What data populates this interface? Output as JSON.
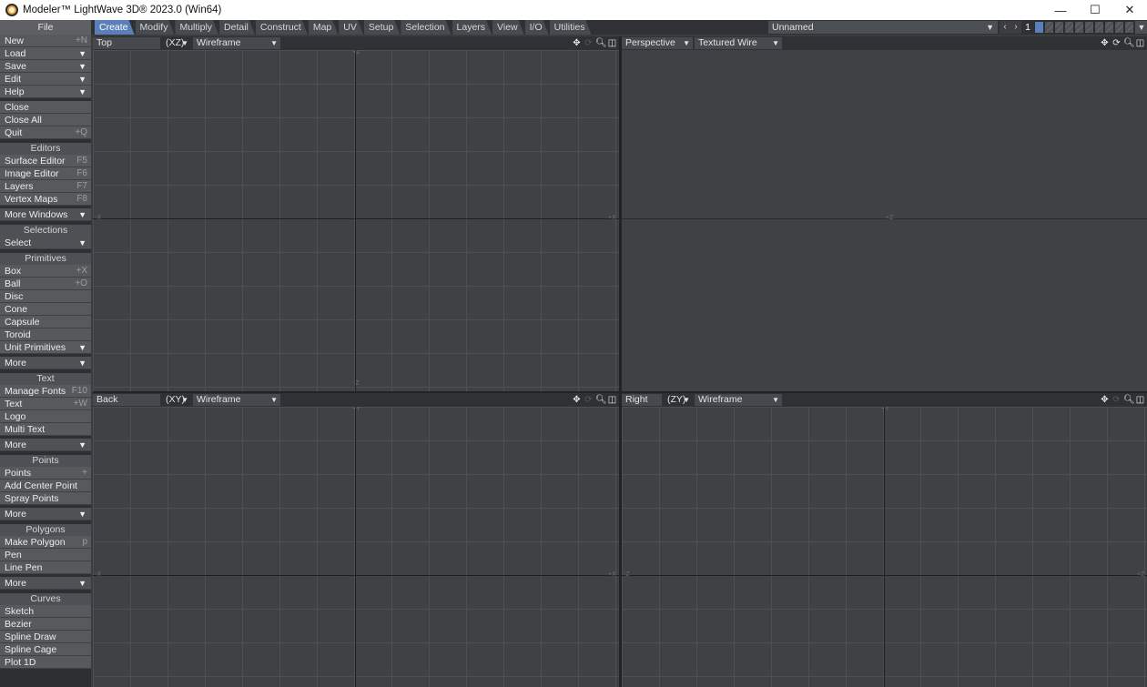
{
  "window": {
    "title": "Modeler™ LightWave 3D® 2023.0 (Win64)",
    "minimize": "—",
    "maximize": "☐",
    "close": "✕"
  },
  "tabbar": {
    "file_label": "File",
    "tabs": [
      {
        "label": "Create",
        "active": true
      },
      {
        "label": "Modify"
      },
      {
        "label": "Multiply"
      },
      {
        "label": "Detail"
      },
      {
        "label": "Construct"
      },
      {
        "label": "Map"
      },
      {
        "label": "UV"
      },
      {
        "label": "Setup"
      },
      {
        "label": "Selection"
      },
      {
        "label": "Layers"
      },
      {
        "label": "View"
      },
      {
        "label": "I/O"
      },
      {
        "label": "Utilities"
      }
    ],
    "object_name": "Unnamed",
    "layer_number": "1"
  },
  "sidebar": {
    "file": {
      "new": {
        "label": "New",
        "shortcut": "+N"
      },
      "load": {
        "label": "Load"
      },
      "save": {
        "label": "Save"
      },
      "edit": {
        "label": "Edit"
      },
      "help": {
        "label": "Help"
      },
      "close": {
        "label": "Close"
      },
      "close_all": {
        "label": "Close All"
      },
      "quit": {
        "label": "Quit",
        "shortcut": "+Q"
      }
    },
    "editors": {
      "title": "Editors",
      "surface": {
        "label": "Surface Editor",
        "shortcut": "F5"
      },
      "image": {
        "label": "Image Editor",
        "shortcut": "F6"
      },
      "layers": {
        "label": "Layers",
        "shortcut": "F7"
      },
      "vertex_maps": {
        "label": "Vertex Maps",
        "shortcut": "F8"
      },
      "more_windows": {
        "label": "More Windows"
      }
    },
    "selections": {
      "title": "Selections",
      "select": {
        "label": "Select"
      }
    },
    "primitives": {
      "title": "Primitives",
      "box": {
        "label": "Box",
        "shortcut": "+X"
      },
      "ball": {
        "label": "Ball",
        "shortcut": "+O"
      },
      "disc": {
        "label": "Disc"
      },
      "cone": {
        "label": "Cone"
      },
      "capsule": {
        "label": "Capsule"
      },
      "toroid": {
        "label": "Toroid"
      },
      "unit_primitives": {
        "label": "Unit Primitives"
      },
      "more": {
        "label": "More"
      }
    },
    "text": {
      "title": "Text",
      "manage_fonts": {
        "label": "Manage Fonts",
        "shortcut": "F10"
      },
      "text": {
        "label": "Text",
        "shortcut": "+W"
      },
      "logo": {
        "label": "Logo"
      },
      "multi_text": {
        "label": "Multi Text"
      },
      "more": {
        "label": "More"
      }
    },
    "points": {
      "title": "Points",
      "points": {
        "label": "Points",
        "shortcut": "+"
      },
      "add_center_point": {
        "label": "Add Center Point"
      },
      "spray_points": {
        "label": "Spray Points"
      },
      "more": {
        "label": "More"
      }
    },
    "polygons": {
      "title": "Polygons",
      "make_polygon": {
        "label": "Make Polygon",
        "shortcut": "p"
      },
      "pen": {
        "label": "Pen"
      },
      "line_pen": {
        "label": "Line Pen"
      },
      "more": {
        "label": "More"
      }
    },
    "curves": {
      "title": "Curves",
      "sketch": {
        "label": "Sketch"
      },
      "bezier": {
        "label": "Bezier"
      },
      "spline_draw": {
        "label": "Spline Draw"
      },
      "spline_cage": {
        "label": "Spline Cage"
      },
      "plot_1d": {
        "label": "Plot 1D"
      }
    }
  },
  "viewports": {
    "top": {
      "view": "Top",
      "axes": "(XZ)",
      "mode": "Wireframe"
    },
    "perspective": {
      "view": "Perspective",
      "mode": "Textured Wire"
    },
    "back": {
      "view": "Back",
      "axes": "(XY)",
      "mode": "Wireframe"
    },
    "right": {
      "view": "Right",
      "axes": "(ZY)",
      "mode": "Wireframe"
    }
  },
  "icons": {
    "move": "move-icon",
    "rotate": "rotate-icon",
    "zoom": "zoom-icon",
    "maximize": "maximize-viewport-icon",
    "chevron": "chevron-down-icon"
  }
}
